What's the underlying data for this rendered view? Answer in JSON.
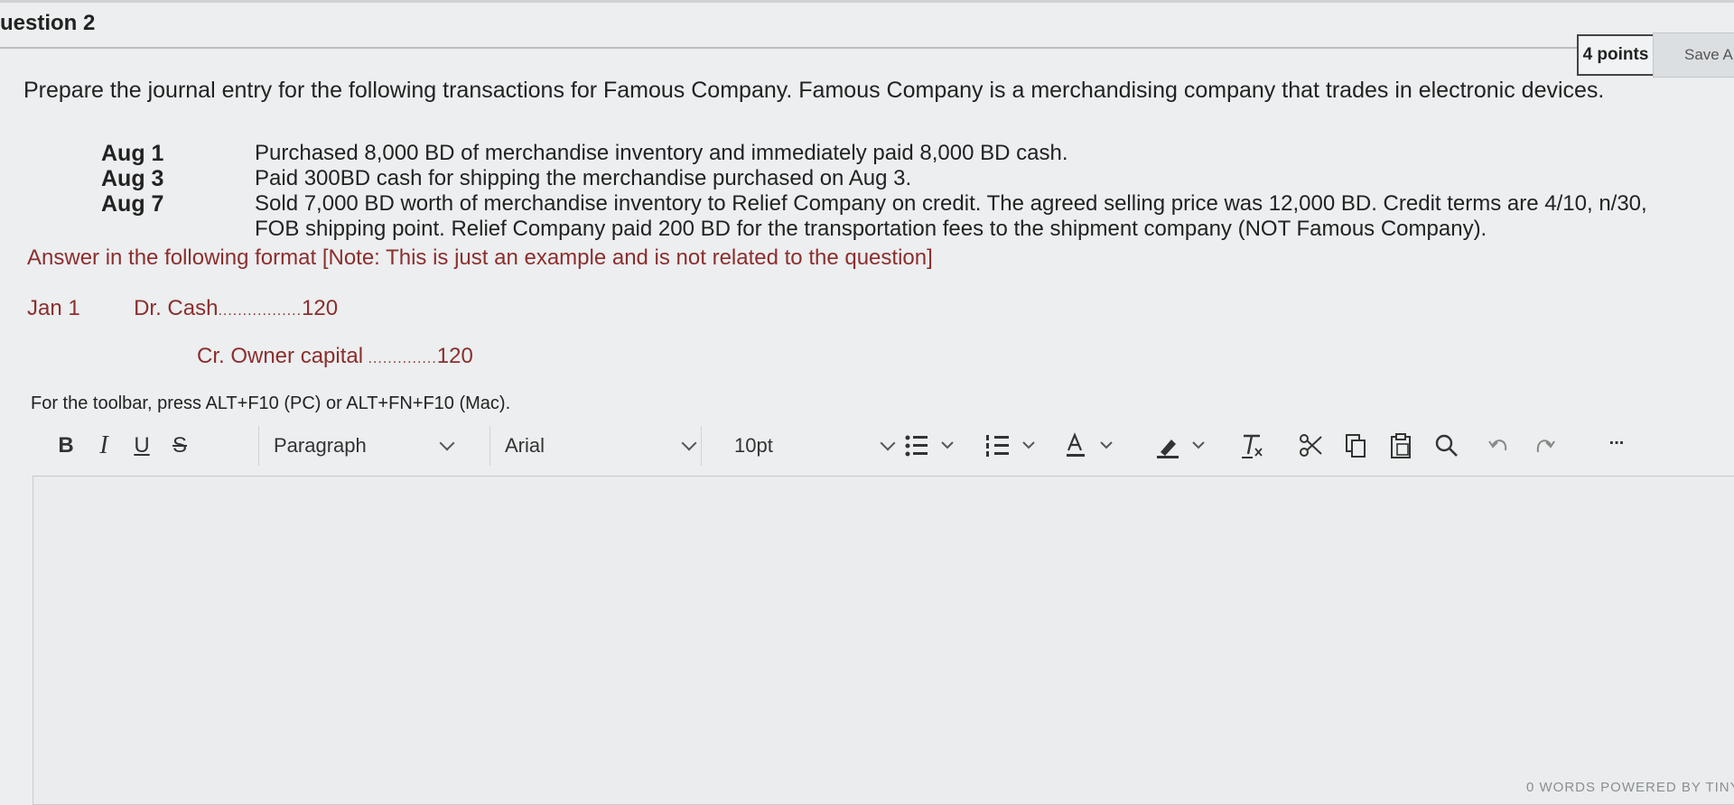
{
  "question": {
    "title": "uestion 2",
    "points": "4 points",
    "save_label": "Save A"
  },
  "prompt": "Prepare the journal entry for the following transactions for Famous Company. Famous Company is a merchandising company that trades in electronic devices.",
  "transactions": [
    {
      "date": "Aug 1",
      "text": "Purchased 8,000 BD of merchandise inventory and immediately paid 8,000 BD cash."
    },
    {
      "date": "Aug 3",
      "text": "Paid 300BD cash for shipping the merchandise purchased on Aug 3."
    },
    {
      "date": "Aug 7",
      "text": "Sold 7,000 BD worth of merchandise inventory to Relief Company on credit. The agreed selling price was 12,000 BD. Credit terms are 4/10, n/30,"
    },
    {
      "date": "",
      "text": "FOB shipping point. Relief Company paid 200 BD for the transportation fees to the shipment company (NOT Famous Company)."
    }
  ],
  "answer_note": "Answer in the following format [Note: This is just an example and is not related to the question]",
  "example": {
    "date": "Jan 1",
    "debit_label": "Dr. Cash",
    "debit_dots": ".................",
    "debit_amount": "120",
    "credit_label": "Cr. Owner capital",
    "credit_dots": " ..............",
    "credit_amount": "120"
  },
  "toolbar_hint": "For the toolbar, press ALT+F10 (PC) or ALT+FN+F10 (Mac).",
  "toolbar": {
    "bold": "B",
    "italic": "I",
    "underline": "U",
    "strike": "S",
    "paragraph": "Paragraph",
    "font": "Arial",
    "size": "10pt",
    "more": "..."
  },
  "footer_note": "0 WORDS   POWERED BY TINY",
  "colors": {
    "example_text": "#8b2e2e",
    "background": "#eceeef"
  }
}
